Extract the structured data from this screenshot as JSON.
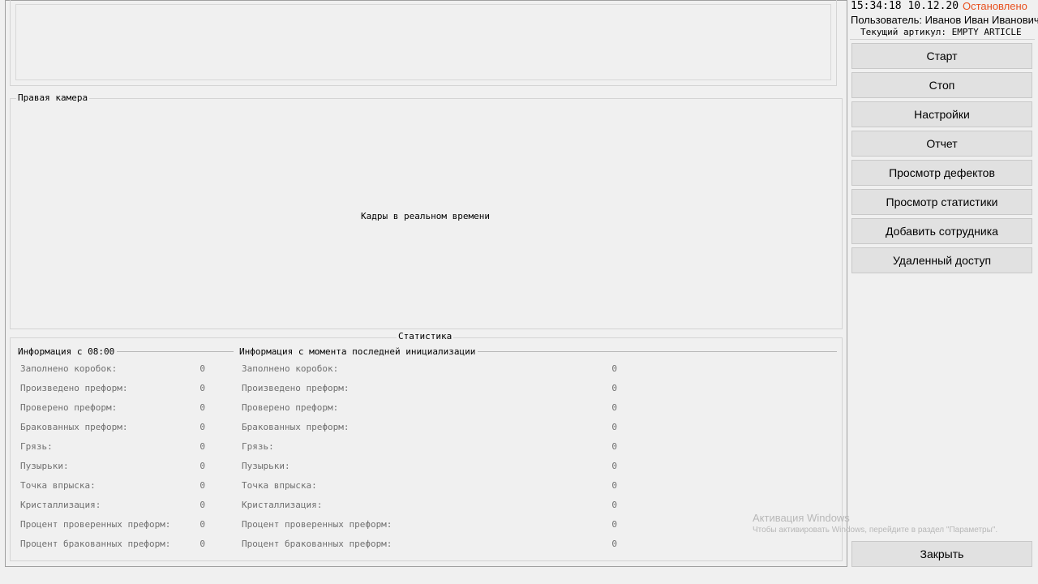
{
  "main": {
    "right_camera": {
      "title": "Правая камера",
      "live_label": "Кадры в реальном времени"
    },
    "statistics": {
      "title": "Статистика",
      "since_shift": {
        "title": "Информация с 08:00",
        "rows": [
          {
            "label": "Заполнено коробок:",
            "value": "0"
          },
          {
            "label": "Произведено преформ:",
            "value": "0"
          },
          {
            "label": "Проверено преформ:",
            "value": "0"
          },
          {
            "label": "Бракованных преформ:",
            "value": "0"
          },
          {
            "label": "Грязь:",
            "value": "0"
          },
          {
            "label": "Пузырьки:",
            "value": "0"
          },
          {
            "label": "Точка впрыска:",
            "value": "0"
          },
          {
            "label": "Кристаллизация:",
            "value": "0"
          },
          {
            "label": "Процент проверенных преформ:",
            "value": "0"
          },
          {
            "label": "Процент бракованных преформ:",
            "value": "0"
          }
        ]
      },
      "since_init": {
        "title": "Информация с момента последней инициализации",
        "rows": [
          {
            "label": "Заполнено коробок:",
            "value": "0"
          },
          {
            "label": "Произведено преформ:",
            "value": "0"
          },
          {
            "label": "Проверено преформ:",
            "value": "0"
          },
          {
            "label": "Бракованных преформ:",
            "value": "0"
          },
          {
            "label": "Грязь:",
            "value": "0"
          },
          {
            "label": "Пузырьки:",
            "value": "0"
          },
          {
            "label": "Точка впрыска:",
            "value": "0"
          },
          {
            "label": "Кристаллизация:",
            "value": "0"
          },
          {
            "label": "Процент проверенных преформ:",
            "value": "0"
          },
          {
            "label": "Процент бракованных преформ:",
            "value": "0"
          }
        ]
      }
    }
  },
  "panel": {
    "datetime": "15:34:18 10.12.20",
    "status": "Остановлено",
    "status_color": "#e8501e",
    "user": "Пользователь: Иванов Иван Иванович",
    "article": "Текущий артикул: EMPTY ARTICLE",
    "buttons": {
      "start": "Старт",
      "stop": "Стоп",
      "settings": "Настройки",
      "report": "Отчет",
      "defects": "Просмотр дефектов",
      "stats": "Просмотр статистики",
      "add_employee": "Добавить сотрудника",
      "remote": "Удаленный доступ",
      "close": "Закрыть"
    }
  },
  "watermark": {
    "title": "Активация Windows",
    "text": "Чтобы активировать Windows, перейдите в раздел \"Параметры\"."
  }
}
